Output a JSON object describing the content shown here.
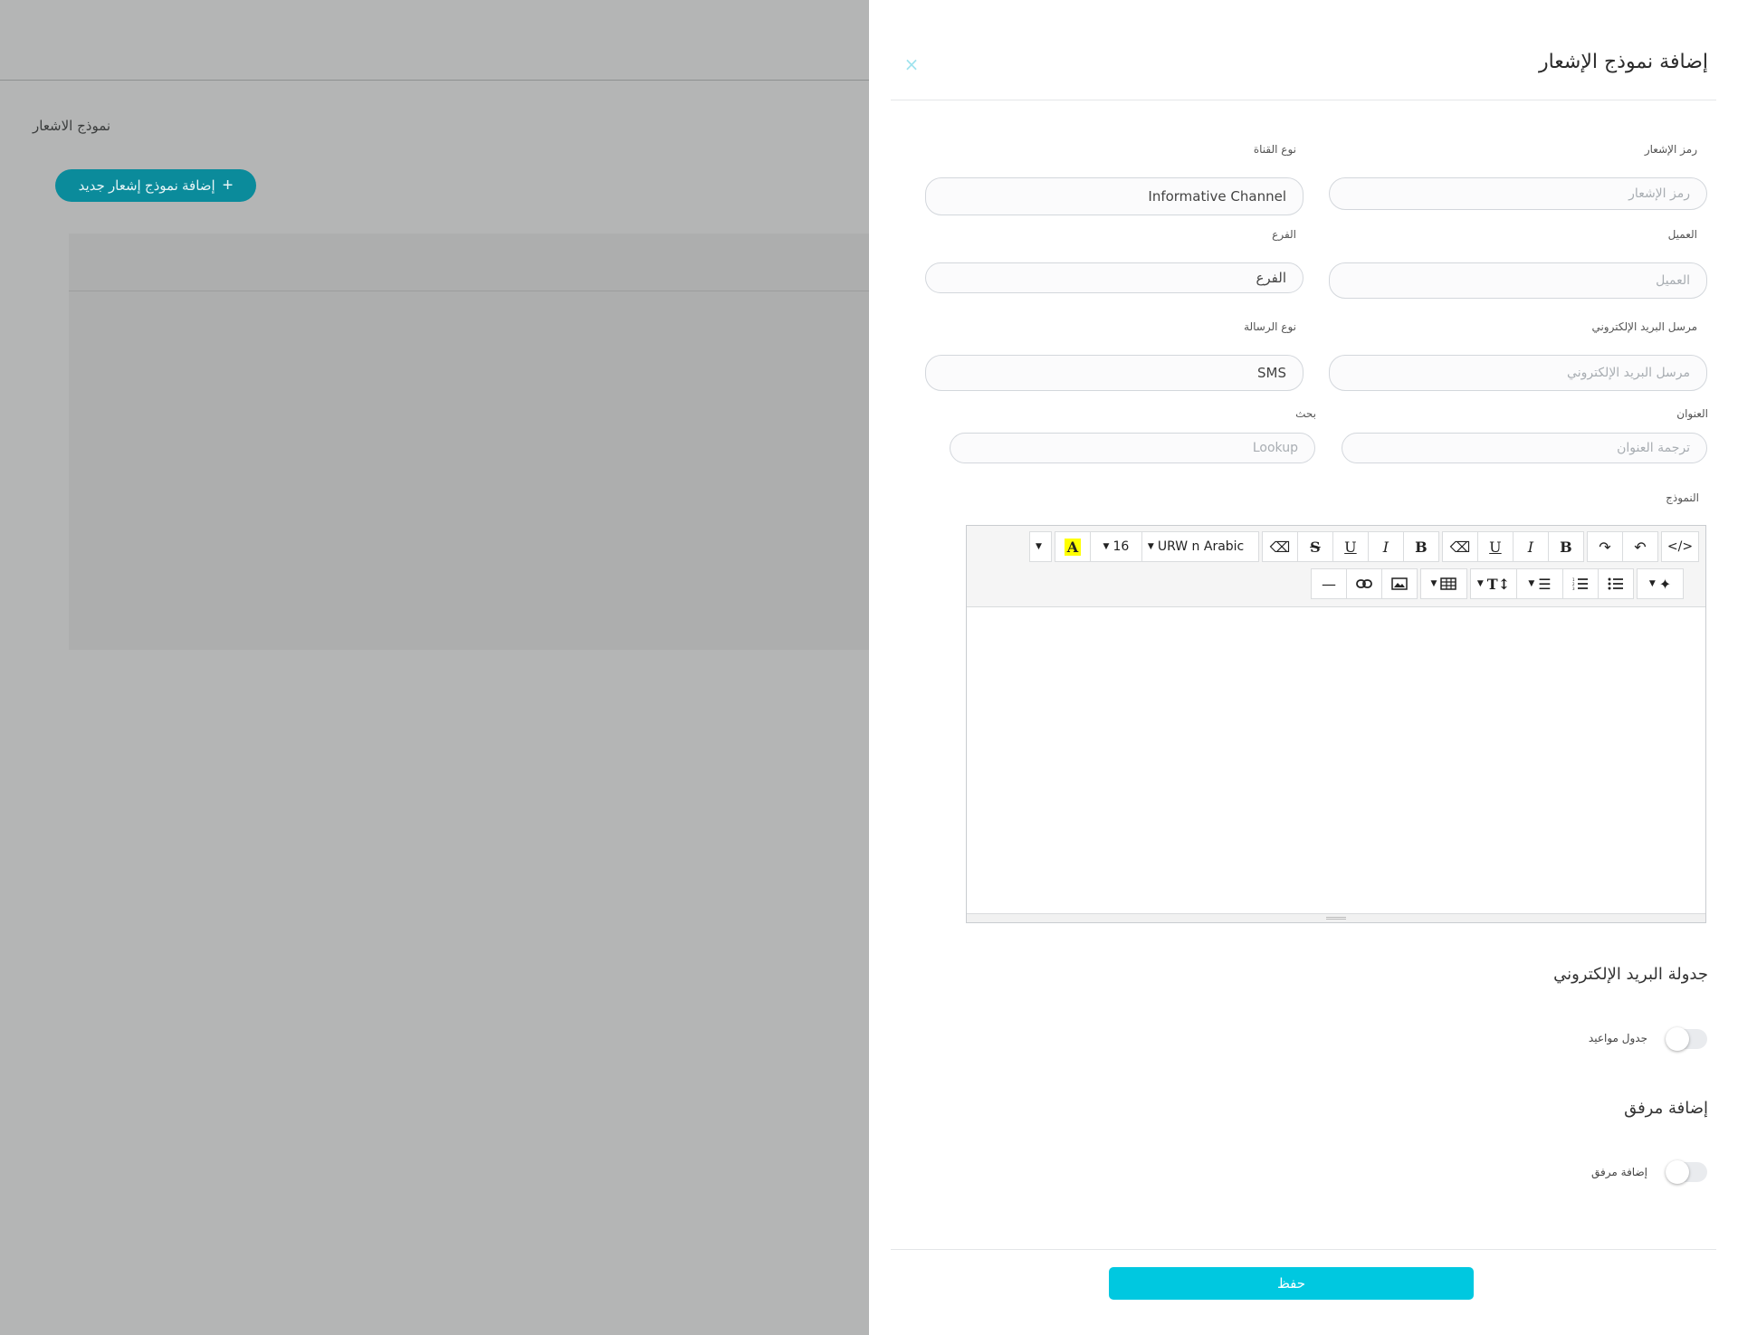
{
  "background": {
    "page_title": "نموذج الاشعار",
    "add_button_label": "إضافة نموذج إشعار جديد",
    "add_button_icon": "plus-icon"
  },
  "drawer": {
    "title": "إضافة نموذج الإشعار",
    "close_icon": "×",
    "fields": {
      "notification_code": {
        "label": "رمز الإشعار",
        "placeholder": "رمز الإشعار"
      },
      "channel_type": {
        "label": "نوع القناة",
        "value": "Informative Channel"
      },
      "client": {
        "label": "العميل",
        "placeholder": "العميل"
      },
      "branch": {
        "label": "الفرع",
        "value": "الفرع"
      },
      "email_sender": {
        "label": "مرسل البريد الإلكتروني",
        "placeholder": "مرسل البريد الإلكتروني"
      },
      "message_type": {
        "label": "نوع الرسالة",
        "value": "SMS"
      },
      "title": {
        "label": "العنوان",
        "placeholder": "ترجمة العنوان"
      },
      "search": {
        "label": "بحث",
        "placeholder": "Lookup"
      },
      "template": {
        "label": "النموذج"
      }
    },
    "editor": {
      "font_name": "URW n Arabic",
      "font_size": "16",
      "code_view": "</>",
      "undo": "↶",
      "redo": "↷",
      "bold": "B",
      "italic": "I",
      "underline": "U",
      "strike": "S",
      "eraser": "⌫",
      "highlight": "A"
    },
    "email_schedule": {
      "section_title": "جدولة البريد الإلكتروني",
      "toggle_label": "جدول مواعيد"
    },
    "attachment": {
      "section_title": "إضافة مرفق",
      "toggle_label": "إضافة مرفق"
    },
    "save_label": "حفظ"
  },
  "colors": {
    "overlay": "#b4b5b5",
    "accent": "#00c8e0",
    "bg_button": "#0b8b9b"
  }
}
